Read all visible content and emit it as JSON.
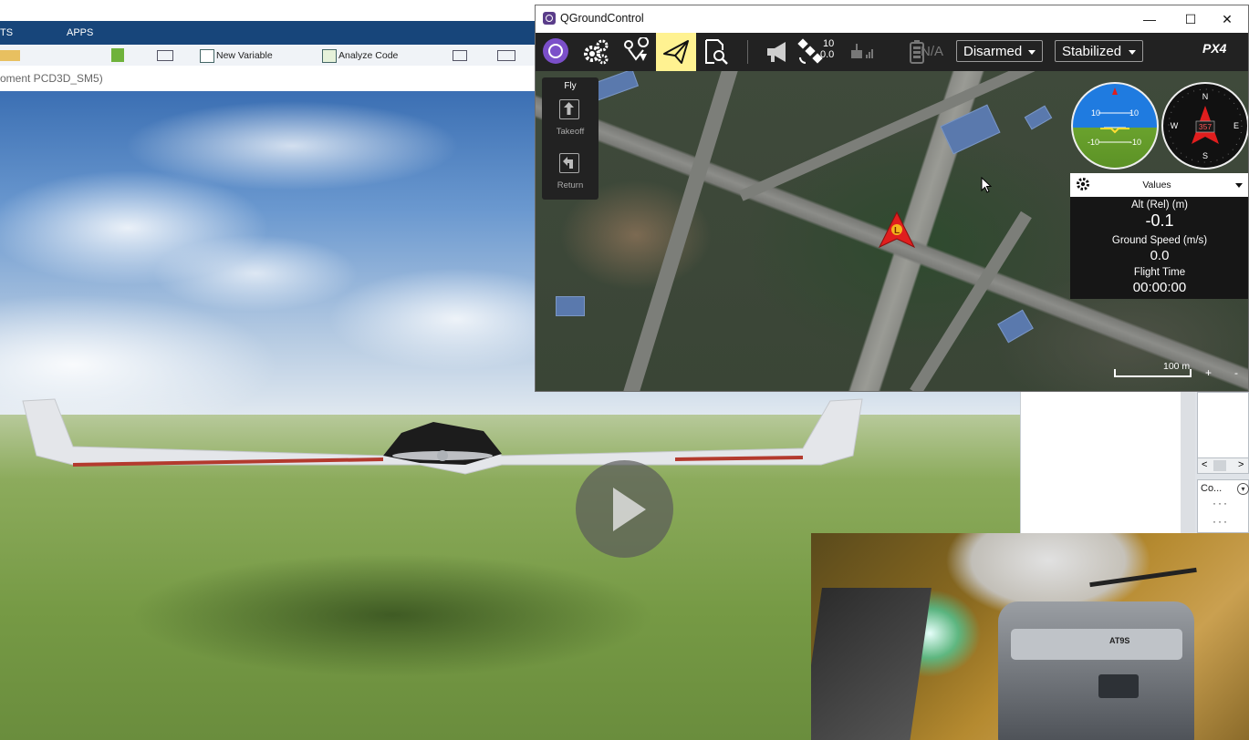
{
  "background_app": {
    "tabs": [
      "TS",
      "APPS"
    ],
    "toolbar": {
      "new_variable": "New Variable",
      "analyze_code": "Analyze Code"
    },
    "path_text": "oment PCD3D_SM5)"
  },
  "qgc": {
    "window_title": "QGroundControl",
    "window_controls": {
      "minimize": "—",
      "maximize": "☐",
      "close": "✕"
    },
    "toolbar": {
      "satellite_count": "10",
      "hdop": "0.0",
      "battery": "N/A",
      "arm_state": "Disarmed",
      "flight_mode": "Stabilized",
      "brand": "PX4"
    },
    "fly_panel": {
      "header": "Fly",
      "takeoff_label": "Takeoff",
      "return_label": "Return"
    },
    "instruments": {
      "pitch_labels": [
        "10",
        "10",
        "-10",
        "-10"
      ],
      "heading": "357",
      "compass": {
        "n": "N",
        "e": "E",
        "s": "S",
        "w": "W"
      }
    },
    "values_panel": {
      "header": "Values",
      "alt_label": "Alt (Rel) (m)",
      "alt_value": "-0.1",
      "speed_label": "Ground Speed (m/s)",
      "speed_value": "0.0",
      "time_label": "Flight Time",
      "time_value": "00:00:00"
    },
    "map": {
      "vehicle_label": "L",
      "scale_label": "100 m",
      "zoom_in": "+",
      "zoom_out": "-"
    }
  },
  "side_panels": {
    "co_label": "Co...",
    "co_button": "▾",
    "scroll_left": "<",
    "scroll_right": ">"
  },
  "webcam": {
    "remote_brand": "AT9S"
  },
  "colors": {
    "fly_highlight": "#fff291",
    "qgc_purple": "#7b4fc9",
    "vehicle_red": "#e01e1e",
    "matlab_blue": "#17457a"
  }
}
